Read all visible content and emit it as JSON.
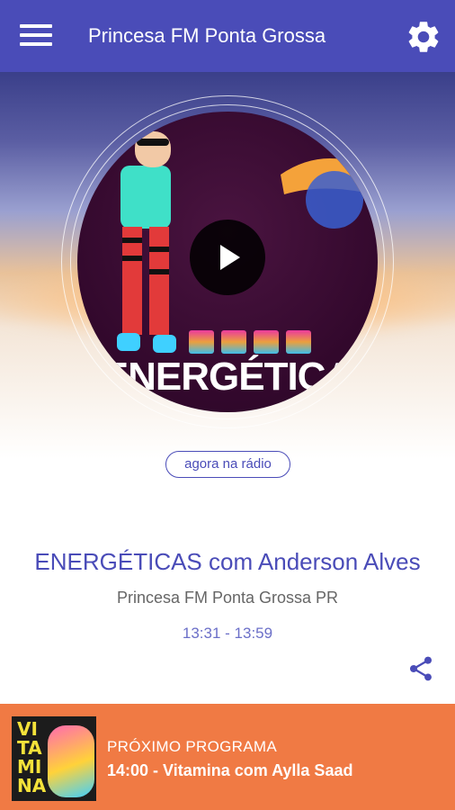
{
  "app_bar": {
    "title": "Princesa FM Ponta Grossa",
    "menu_icon": "hamburger-menu-icon",
    "settings_icon": "gear-icon"
  },
  "colors": {
    "primary": "#4a4cb8",
    "accent_orange": "#f07a44",
    "subtitle_gray": "#666666",
    "time_color": "#6b6fc8"
  },
  "player": {
    "cover_text": "ENERGÉTICA",
    "play_icon": "play-icon",
    "badge_label": "agora na rádio"
  },
  "now_playing": {
    "program": "ENERGÉTICAS com Anderson Alves",
    "station": "Princesa FM Ponta Grossa PR",
    "time": "13:31 - 13:59",
    "share_icon": "share-icon"
  },
  "next": {
    "label": "PRÓXIMO PROGRAMA",
    "program": "14:00 - Vitamina com Aylla Saad",
    "thumb_text": "VITAMINA"
  }
}
